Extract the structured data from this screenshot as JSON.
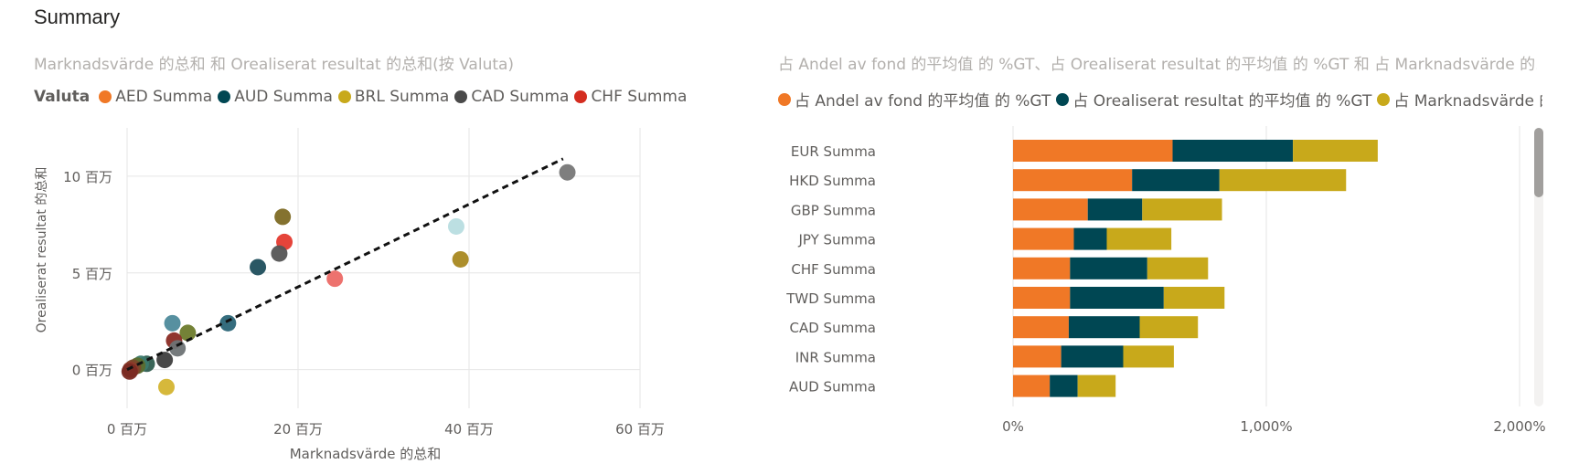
{
  "page": {
    "title": "Summary"
  },
  "scatter": {
    "subtitle": "Marknadsvärde 的总和 和 Orealiserat resultat 的总和(按 Valuta)",
    "legend_title": "Valuta",
    "legend": [
      {
        "label": "AED Summa",
        "color": "#f07826"
      },
      {
        "label": "AUD Summa",
        "color": "#004753"
      },
      {
        "label": "BRL Summa",
        "color": "#c8a91b"
      },
      {
        "label": "CAD Summa",
        "color": "#4a4a4a"
      },
      {
        "label": "CHF Summa",
        "color": "#d42d20"
      }
    ]
  },
  "bars": {
    "subtitle": "占 Andel av fond 的平均值 的 %GT、占 Orealiserat resultat 的平均值 的 %GT 和 占 Marknadsvärde 的...",
    "legend": [
      {
        "label": "占 Andel av fond 的平均值 的 %GT",
        "color": "#f07826"
      },
      {
        "label": "占 Orealiserat resultat 的平均值 的 %GT",
        "color": "#004753"
      },
      {
        "label": "占 Marknadsvärde 的平",
        "color": "#c8a91b"
      }
    ]
  },
  "chart_data": [
    {
      "type": "scatter",
      "title": "Marknadsvärde 的总和 和 Orealiserat resultat 的总和(按 Valuta)",
      "xlabel": "Marknadsvärde 的总和",
      "ylabel": "Orealiserat resultat 的总和",
      "xlim": [
        0,
        60
      ],
      "ylim": [
        -2,
        12.5
      ],
      "x_ticks": [
        0,
        20,
        40,
        60
      ],
      "x_tick_labels": [
        "0 百万",
        "20 百万",
        "40 百万",
        "60 百万"
      ],
      "y_ticks": [
        0,
        5,
        10
      ],
      "y_tick_labels": [
        "0 百万",
        "5 百万",
        "10 百万"
      ],
      "unit": "百万",
      "grid": true,
      "trend_line": {
        "x": [
          0,
          51
        ],
        "y": [
          0,
          10.9
        ]
      },
      "points": [
        {
          "x": 51.5,
          "y": 10.2,
          "color": "#777777"
        },
        {
          "x": 38.5,
          "y": 7.4,
          "color": "#b8dde0"
        },
        {
          "x": 39.0,
          "y": 5.7,
          "color": "#a88820"
        },
        {
          "x": 18.2,
          "y": 7.9,
          "color": "#7d6a24"
        },
        {
          "x": 18.4,
          "y": 6.6,
          "color": "#e43a2f"
        },
        {
          "x": 17.8,
          "y": 6.0,
          "color": "#555555"
        },
        {
          "x": 15.3,
          "y": 5.3,
          "color": "#1f4e5c"
        },
        {
          "x": 24.3,
          "y": 4.7,
          "color": "#ec6a66"
        },
        {
          "x": 11.8,
          "y": 2.4,
          "color": "#2a6577"
        },
        {
          "x": 5.3,
          "y": 2.4,
          "color": "#4e8a9b"
        },
        {
          "x": 7.1,
          "y": 1.9,
          "color": "#6d7b2c"
        },
        {
          "x": 5.5,
          "y": 1.5,
          "color": "#8a2b24"
        },
        {
          "x": 5.9,
          "y": 1.1,
          "color": "#6e7375"
        },
        {
          "x": 4.4,
          "y": 0.5,
          "color": "#3e3e3e"
        },
        {
          "x": 4.6,
          "y": -0.9,
          "color": "#d4b430"
        },
        {
          "x": 2.3,
          "y": 0.3,
          "color": "#2f5d4f"
        },
        {
          "x": 1.6,
          "y": 0.3,
          "color": "#3b7a6e"
        },
        {
          "x": 1.2,
          "y": 0.2,
          "color": "#5b6d2e"
        },
        {
          "x": 0.7,
          "y": 0.1,
          "color": "#7a4a2a"
        },
        {
          "x": 0.4,
          "y": 0.0,
          "color": "#8c3a2a"
        },
        {
          "x": 0.3,
          "y": -0.1,
          "color": "#7a2a22"
        }
      ]
    },
    {
      "type": "bar",
      "orientation": "horizontal",
      "stacked": true,
      "title": "占 Andel av fond 的平均值 的 %GT、占 Orealiserat resultat 的平均值 的 %GT 和 占 Marknadsvärde 的...",
      "categories": [
        "EUR Summa",
        "HKD Summa",
        "GBP Summa",
        "JPY Summa",
        "CHF Summa",
        "TWD Summa",
        "CAD Summa",
        "INR Summa",
        "AUD Summa"
      ],
      "series": [
        {
          "name": "占 Andel av fond 的平均值 的 %GT",
          "color": "#f07826",
          "values": [
            630,
            470,
            295,
            240,
            225,
            225,
            220,
            190,
            145
          ]
        },
        {
          "name": "占 Orealiserat resultat 的平均值 的 %GT",
          "color": "#004753",
          "values": [
            475,
            345,
            215,
            130,
            305,
            370,
            280,
            245,
            110
          ]
        },
        {
          "name": "占 Marknadsvärde 的平",
          "color": "#c8a91b",
          "values": [
            335,
            500,
            315,
            255,
            240,
            240,
            230,
            200,
            150
          ]
        }
      ],
      "xlim": [
        0,
        2000
      ],
      "x_ticks": [
        0,
        1000,
        2000
      ],
      "x_tick_labels": [
        "0%",
        "1,000%",
        "2,000%"
      ],
      "grid": true
    }
  ]
}
